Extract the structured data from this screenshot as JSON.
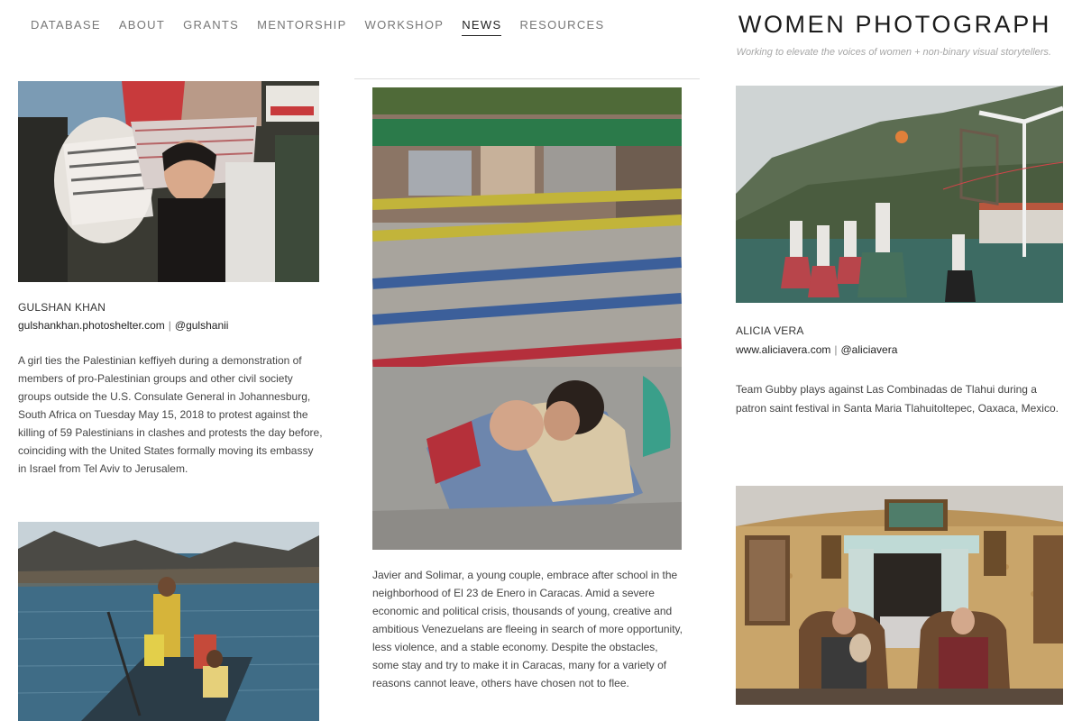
{
  "nav": {
    "items": [
      {
        "label": "DATABASE"
      },
      {
        "label": "ABOUT"
      },
      {
        "label": "GRANTS"
      },
      {
        "label": "MENTORSHIP"
      },
      {
        "label": "WORKSHOP"
      },
      {
        "label": "NEWS",
        "active": true
      },
      {
        "label": "RESOURCES"
      }
    ]
  },
  "brand": {
    "title": "WOMEN PHOTOGRAPH",
    "tagline": "Working to elevate the voices of women + non-binary visual storytellers."
  },
  "posts": {
    "gulshan": {
      "photographer": "GULSHAN KHAN",
      "website": "gulshankhan.photoshelter.com",
      "separator": "|",
      "handle": "@gulshanii",
      "caption": "A girl ties the Palestinian keffiyeh during a demonstration of members of pro-Palestinian groups and other civil society groups outside the U.S. Consulate General in Johannesburg, South Africa on Tuesday May 15, 2018 to protest against the killing of 59 Palestinians in clashes and protests the day before, coinciding with the United States formally moving its embassy in Israel from Tel Aviv to Jerusalem."
    },
    "caracas": {
      "caption": "Javier and Solimar, a young couple, embrace after school in the neighborhood of El 23 de Enero in Caracas. Amid a severe economic and political crisis, thousands of young, creative and ambitious Venezuelans are fleeing in search of more opportunity, less violence, and a stable economy. Despite the obstacles, some stay and try to make it in Caracas, many for a variety of reasons cannot leave, others have chosen not to flee."
    },
    "alicia": {
      "photographer": "ALICIA VERA",
      "website": "www.aliciavera.com",
      "separator": "|",
      "handle": "@aliciavera",
      "caption": "Team Gubby plays against Las Combinadas de Tlahui during a patron saint festival in Santa Maria Tlahuitoltepec, Oaxaca, Mexico."
    }
  },
  "colors": {
    "nav_text": "#777777",
    "nav_active": "#222222",
    "tagline": "#a7a7a7"
  }
}
